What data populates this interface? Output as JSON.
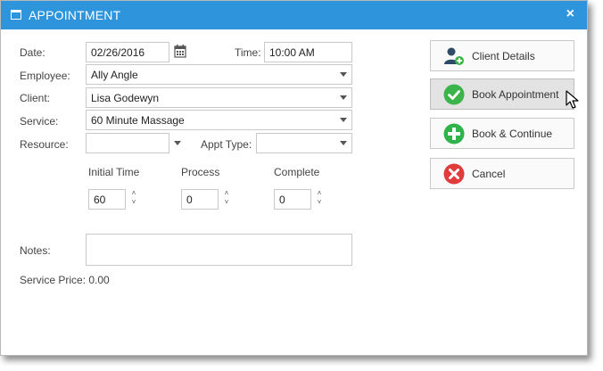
{
  "window": {
    "title": "APPOINTMENT",
    "close_glyph": "×"
  },
  "form": {
    "date_label": "Date:",
    "date_value": "02/26/2016",
    "time_label": "Time:",
    "time_value": "10:00 AM",
    "employee_label": "Employee:",
    "employee_value": "Ally Angle",
    "client_label": "Client:",
    "client_value": "Lisa Godewyn",
    "service_label": "Service:",
    "service_value": "60 Minute Massage",
    "resource_label": "Resource:",
    "resource_value": "",
    "appt_type_label": "Appt Type:",
    "appt_type_value": "",
    "initial_time_label": "Initial Time",
    "initial_time_value": "60",
    "process_label": "Process",
    "process_value": "0",
    "complete_label": "Complete",
    "complete_value": "0",
    "notes_label": "Notes:",
    "notes_value": "",
    "service_price_label": "Service Price:",
    "service_price_value": "0.00"
  },
  "actions": {
    "client_details": "Client Details",
    "book_appointment": "Book Appointment",
    "book_continue": "Book & Continue",
    "cancel": "Cancel"
  },
  "colors": {
    "titlebar": "#2e95dc",
    "check_green": "#3bb44a",
    "plus_green": "#2fb34a",
    "cancel_red": "#e03c3c",
    "user_icon": "#2d4a66"
  }
}
